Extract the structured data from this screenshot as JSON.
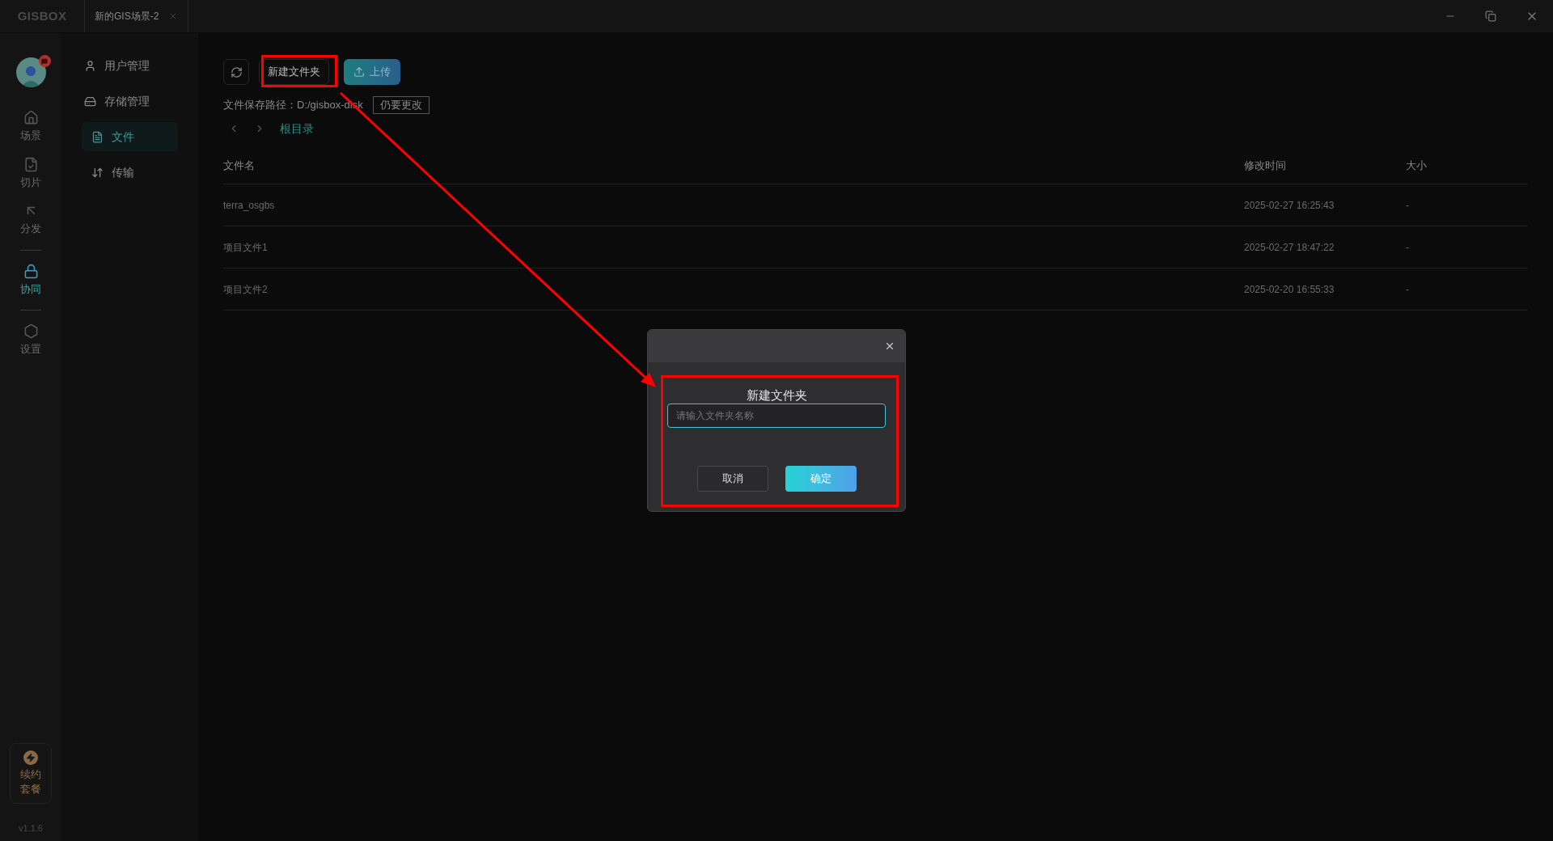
{
  "app": {
    "logo": "GISBOX",
    "version": "v1.1.6"
  },
  "tabs": [
    {
      "label": "新的GIS场景-2",
      "selected": true
    }
  ],
  "rail": [
    {
      "label": "场景",
      "kind": "home",
      "selected": false
    },
    {
      "label": "切片",
      "kind": "check",
      "selected": false
    },
    {
      "label": "分发",
      "kind": "share",
      "selected": false
    },
    {
      "label": "协同",
      "kind": "lock",
      "selected": true
    },
    {
      "label": "设置",
      "kind": "gear",
      "selected": false
    }
  ],
  "renew": {
    "label": "续约套餐"
  },
  "sidebar": {
    "items": [
      {
        "label": "用户管理",
        "kind": "user",
        "selected": false
      },
      {
        "label": "存储管理",
        "kind": "storage",
        "selected": false
      },
      {
        "label": "文件",
        "kind": "file",
        "selected": true
      },
      {
        "label": "传输",
        "kind": "transfer",
        "selected": false
      }
    ]
  },
  "toolbar": {
    "new_folder": "新建文件夹",
    "upload": "上传"
  },
  "path": {
    "label": "文件保存路径：",
    "value": "D:/gisbox-disk",
    "change": "仍要更改"
  },
  "breadcrumb": {
    "root": "根目录"
  },
  "table": {
    "columns": [
      "文件名",
      "修改时间",
      "大小"
    ],
    "rows": [
      [
        "terra_osgbs",
        "2025-02-27 16:25:43",
        "-"
      ],
      [
        "项目文件1",
        "2025-02-27 18:47:22",
        "-"
      ],
      [
        "项目文件2",
        "2025-02-20 16:55:33",
        "-"
      ]
    ]
  },
  "dialog": {
    "title": "新建文件夹",
    "placeholder": "请输入文件夹名称",
    "cancel": "取消",
    "confirm": "确定"
  }
}
